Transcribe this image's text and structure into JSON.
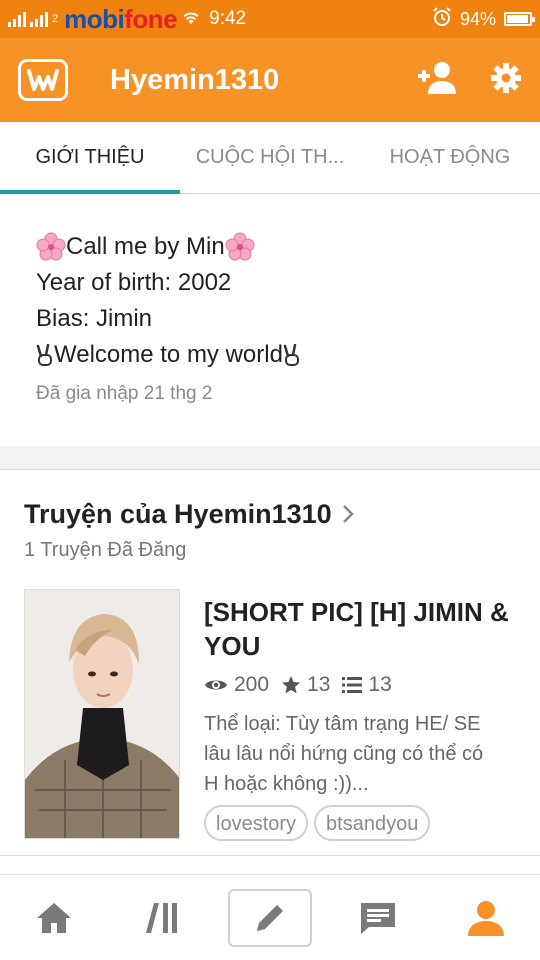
{
  "status_bar": {
    "carrier_prefix": "mobi",
    "carrier_suffix": "fone",
    "sim_label": "2",
    "time": "9:42",
    "battery": "94%",
    "battery_level": 0.94
  },
  "app_bar": {
    "title": "Hyemin1310",
    "icons": [
      "wattpad-logo-icon",
      "add-person-icon",
      "gear-icon"
    ]
  },
  "tabs": [
    {
      "label": "GIỚI THIỆU",
      "active": true
    },
    {
      "label": "CUỘC HỘI TH...",
      "active": false
    },
    {
      "label": "HOẠT ĐỘNG",
      "active": false
    }
  ],
  "about": {
    "line1": "Call me by Min",
    "line2": "Year of birth: 2002",
    "line3": "Bias: Jimin",
    "line4": "Welcome to my world",
    "joined": "Đã gia nhập 21 thg 2"
  },
  "stories": {
    "header": "Truyện của Hyemin1310",
    "count": "1 Truyện Đã Đăng",
    "items": [
      {
        "title": "[SHORT PIC] [H] JIMIN & YOU",
        "reads": "200",
        "votes": "13",
        "parts": "13",
        "description": "Thể loại: Tùy tâm trạng HE/ SE lâu lâu nổi hứng cũng có thể có H hoặc không :))...",
        "tags": [
          "lovestory",
          "btsandyou"
        ]
      }
    ]
  },
  "bottom_nav": {
    "items": [
      "home-icon",
      "library-icon",
      "write-icon",
      "messages-icon",
      "profile-icon"
    ],
    "active": "profile-icon"
  },
  "colors": {
    "status_bar": "#f0820f",
    "app_bar": "#f79226",
    "accent_tab": "#19a2a5",
    "active_nav": "#f79226"
  }
}
